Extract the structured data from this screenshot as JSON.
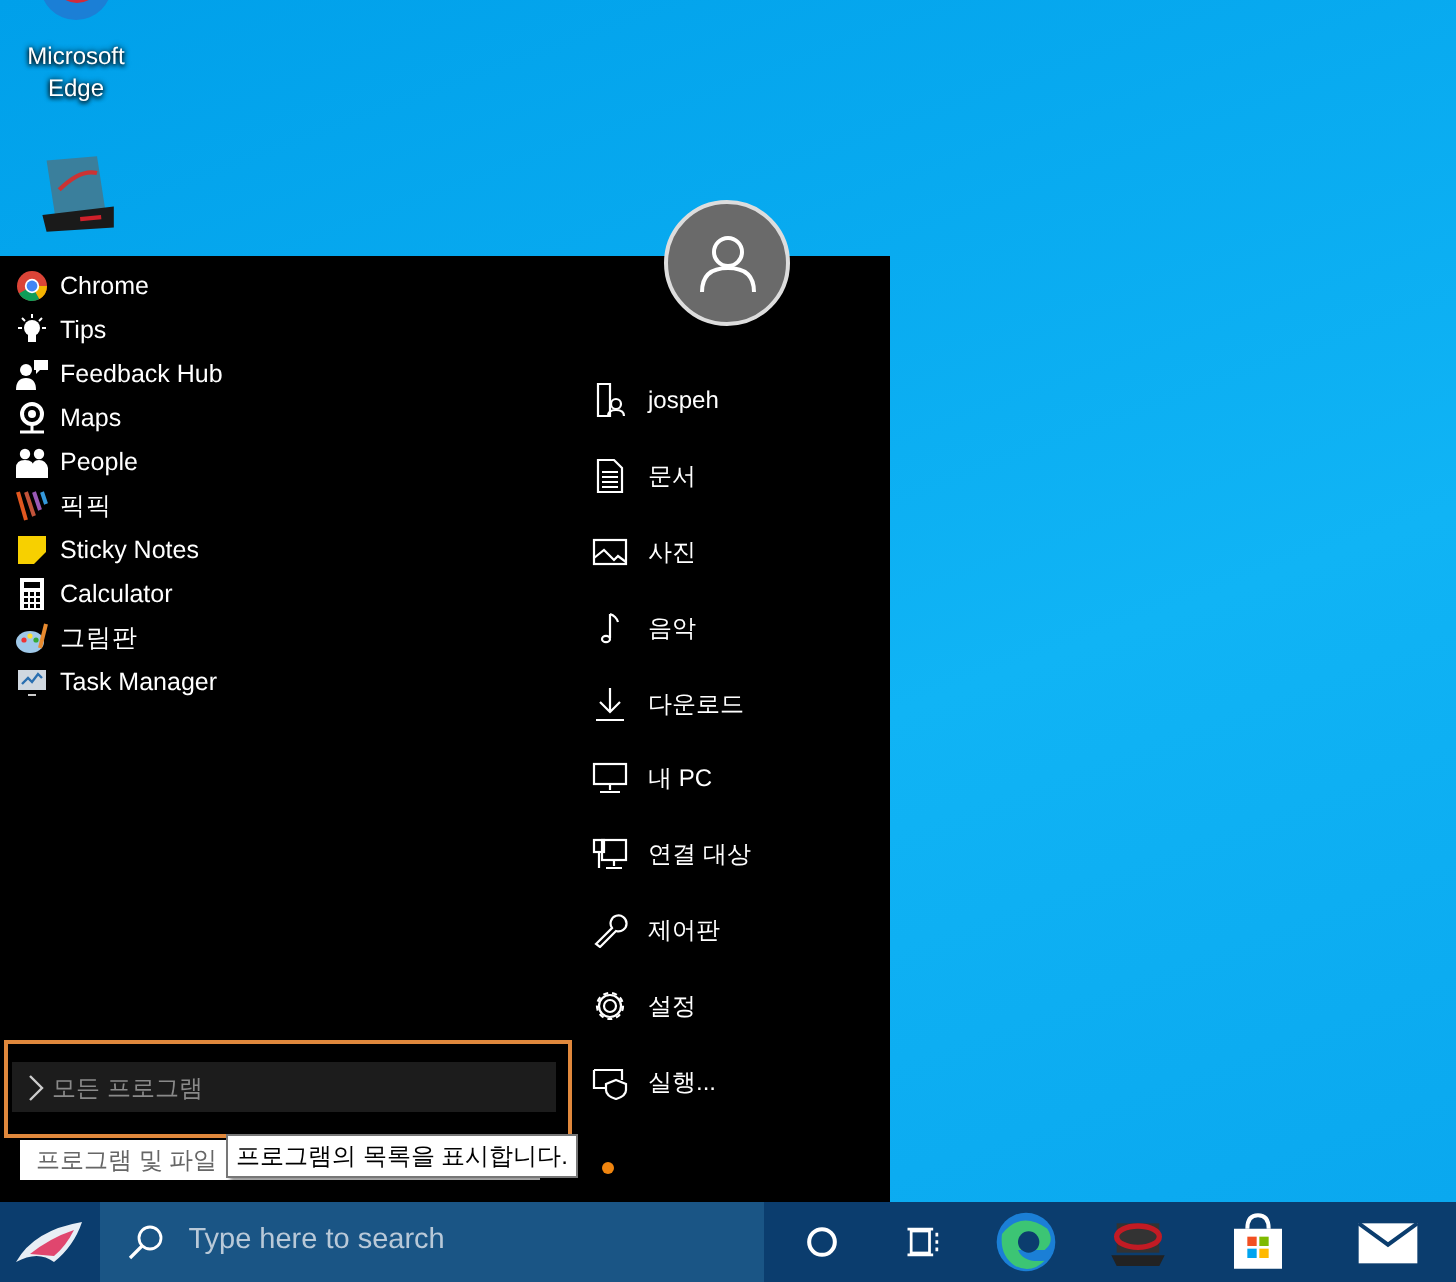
{
  "desktop_icons": [
    {
      "label": "Microsoft Edge"
    },
    {
      "kind": "laptop"
    }
  ],
  "start_menu": {
    "apps": [
      {
        "label": "Chrome"
      },
      {
        "label": "Tips"
      },
      {
        "label": "Feedback Hub"
      },
      {
        "label": "Maps"
      },
      {
        "label": "People"
      },
      {
        "label": "픽픽"
      },
      {
        "label": "Sticky Notes"
      },
      {
        "label": "Calculator"
      },
      {
        "label": "그림판"
      },
      {
        "label": "Task Manager"
      }
    ],
    "places": [
      {
        "label": "jospeh"
      },
      {
        "label": "문서"
      },
      {
        "label": "사진"
      },
      {
        "label": "음악"
      },
      {
        "label": "다운로드"
      },
      {
        "label": "내 PC"
      },
      {
        "label": "연결 대상"
      },
      {
        "label": "제어판"
      },
      {
        "label": "설정"
      },
      {
        "label": "실행..."
      }
    ],
    "all_programs": {
      "label": "모든 프로그램",
      "focused": true
    },
    "search": {
      "placeholder": "프로그램 및 파일"
    },
    "tooltip": "프로그램의 목록을 표시합니다."
  },
  "taskbar": {
    "search": {
      "placeholder": "Type here to search"
    }
  }
}
